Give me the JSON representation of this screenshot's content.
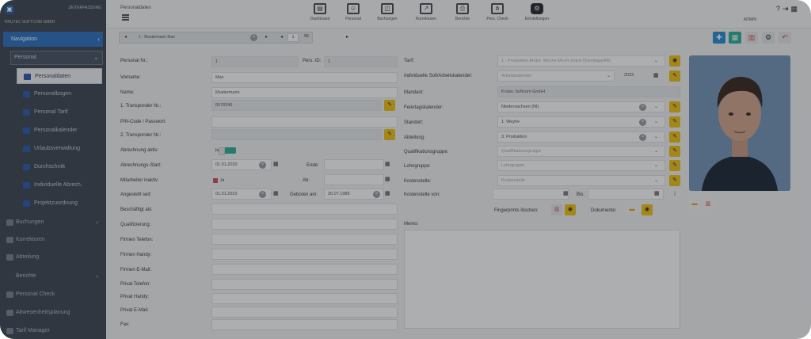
{
  "sidebar": {
    "brand_top": "ZEITERFASSUNG",
    "brand_bottom": "KRUTEC SOFTCOM GMBH",
    "nav_label": "Navigation",
    "personal_label": "Personal",
    "items": [
      {
        "label": "Personaldaten"
      },
      {
        "label": "Personalbogen"
      },
      {
        "label": "Personal Tarif"
      },
      {
        "label": "Personalkalender"
      },
      {
        "label": "Urlaubsverwaltung"
      },
      {
        "label": "Durchschnitt"
      },
      {
        "label": "Individuelle Abrech."
      },
      {
        "label": "Projektzuordnung"
      }
    ],
    "sections": [
      {
        "label": "Buchungen"
      },
      {
        "label": "Korrekturen"
      },
      {
        "label": "Abteilung"
      },
      {
        "label": "Berichte"
      },
      {
        "label": "Personal Check"
      },
      {
        "label": "Abwesenheitsplanung"
      },
      {
        "label": "Tarif Manager"
      }
    ]
  },
  "topbar": {
    "page_name": "Personaldaten",
    "admin": "ADMIN",
    "buttons": [
      {
        "label": "Dashboard"
      },
      {
        "label": "Personal"
      },
      {
        "label": "Buchungen"
      },
      {
        "label": "Korrekturen"
      },
      {
        "label": "Berichte"
      },
      {
        "label": "Pers. Check"
      },
      {
        "label": "Einstellungen"
      }
    ]
  },
  "record": {
    "title": "1 - Mustermann Max",
    "page": "1",
    "total": "55"
  },
  "form": {
    "personal_nr_label": "Personal Nr.:",
    "personal_nr": "1",
    "pers_id_label": "Pers. ID:",
    "pers_id": "1",
    "vorname_label": "Vorname:",
    "vorname": "Max",
    "name_label": "Name:",
    "name": "Mustermann",
    "transponder1_label": "1. Transponder Nr.:",
    "transponder1": "6578245",
    "pin_label": "PIN-Code / Passwort:",
    "transponder2_label": "2. Transponder Nr.:",
    "abrechnung_label": "Abrechnung aktiv:",
    "abrechnung_value": "Ja",
    "abr_start_label": "Abrechnungs-Start:",
    "abr_start": "01.01.2020",
    "ende_label": "Ende:",
    "inaktiv_label": "Mitarbeiter inaktiv:",
    "inaktiv_value": "Ja",
    "ab_label": "Ab:",
    "angestellt_label": "Angestellt seit:",
    "angestellt": "01.01.2023",
    "geboren_label": "Geboren am:",
    "geboren": "26.07.1989",
    "beschaeftigt_label": "Beschäftigt als:",
    "qualifizierung_label": "Qualifizierung:",
    "firmen_telefon_label": "Firmen Telefon:",
    "firmen_handy_label": "Firmen Handy:",
    "firmen_email_label": "Firmen E-Mail:",
    "privat_telefon_label": "Privat Telefon:",
    "privat_handy_label": "Privat Handy:",
    "privat_email_label": "Privat E-Mail:",
    "fax_label": "Fax:"
  },
  "right_form": {
    "tarif_label": "Tarif:",
    "tarif": "1 - Produktion Ahdst. Woche Mo-Fr (mich-/Sonntags/AB)",
    "soll_label": "Individuelle Soll/Arbeitskalender:",
    "soll": "Arbeitskalender",
    "soll_year": "2023",
    "mandant_label": "Mandant:",
    "mandant": "Krutec Softcom GmbH",
    "feiertag_label": "Feiertagskalender:",
    "feiertag": "Niedersachsen (NI)",
    "standort_label": "Standort:",
    "standort": "1. Weyhe",
    "abteilung_label": "Abteilung:",
    "abteilung": "3. Produktion",
    "qualifikation_label": "Qualifikationsgruppe:",
    "qualifikation": "Qualifikationsgruppe",
    "lohngruppe_label": "Lohngruppe:",
    "lohngruppe": "Lohngruppe",
    "kostenstelle_label": "Kostenstelle:",
    "kostenstelle": "Kostenstelle",
    "ks_von_label": "Kostenstelle von:",
    "bis_label": "Bis:",
    "fingerprints_label": "Fingerprints löschen:",
    "dokumente_label": "Dokumente:",
    "memo_label": "Memo:"
  },
  "colors": {
    "sidebar_bg": "#3f4957",
    "accent": "#2f74c4",
    "yellow": "#f0c419",
    "teal": "#2bb39a",
    "red": "#d9534f"
  }
}
